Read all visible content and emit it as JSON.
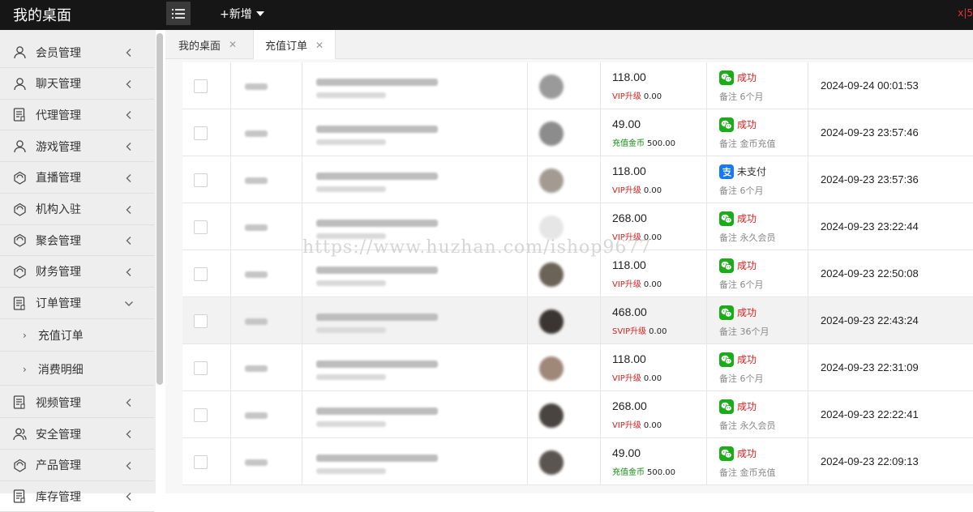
{
  "header": {
    "title": "我的桌面",
    "add_label": "+新增",
    "right_text": "x|5"
  },
  "sidebar": {
    "items": [
      {
        "label": "会员管理",
        "icon": "user-icon"
      },
      {
        "label": "聊天管理",
        "icon": "user-icon"
      },
      {
        "label": "代理管理",
        "icon": "document-icon"
      },
      {
        "label": "游戏管理",
        "icon": "user-icon"
      },
      {
        "label": "直播管理",
        "icon": "bell-icon"
      },
      {
        "label": "机构入驻",
        "icon": "bell-icon"
      },
      {
        "label": "聚会管理",
        "icon": "bell-icon"
      },
      {
        "label": "财务管理",
        "icon": "bell-icon"
      },
      {
        "label": "订单管理",
        "icon": "document-icon"
      }
    ],
    "sub_items": [
      {
        "label": "充值订单"
      },
      {
        "label": "消费明细"
      }
    ],
    "items_after": [
      {
        "label": "视频管理",
        "icon": "document-icon"
      },
      {
        "label": "安全管理",
        "icon": "users-icon"
      },
      {
        "label": "产品管理",
        "icon": "bell-icon"
      },
      {
        "label": "库存管理",
        "icon": "document-icon"
      }
    ]
  },
  "tabs": [
    {
      "label": "我的桌面"
    },
    {
      "label": "充值订单"
    }
  ],
  "colors": {
    "vip": "#e02020",
    "coin": "#0c8a0c",
    "success": "#e02020",
    "wechat": "#1aad19",
    "alipay": "#1677ff"
  },
  "orders": [
    {
      "amount": "118.00",
      "type": "VIP升级",
      "type_value": "0.00",
      "type_color": "vip",
      "pay": "wechat",
      "status": "成功",
      "remark": "备注 6个月",
      "time": "2024-09-24 00:01:53",
      "avatar": "#9a9a9a"
    },
    {
      "amount": "49.00",
      "type": "充值金币",
      "type_value": "500.00",
      "type_color": "coin",
      "pay": "wechat",
      "status": "成功",
      "remark": "备注 金币充值",
      "time": "2024-09-23 23:57:46",
      "avatar": "#8c8c8c"
    },
    {
      "amount": "118.00",
      "type": "VIP升级",
      "type_value": "0.00",
      "type_color": "vip",
      "pay": "alipay",
      "status": "未支付",
      "remark": "备注 6个月",
      "time": "2024-09-23 23:57:36",
      "avatar": "#a39b92"
    },
    {
      "amount": "268.00",
      "type": "VIP升级",
      "type_value": "0.00",
      "type_color": "vip",
      "pay": "wechat",
      "status": "成功",
      "remark": "备注 永久会员",
      "time": "2024-09-23 23:22:44",
      "avatar": "#e6e6e6"
    },
    {
      "amount": "118.00",
      "type": "VIP升级",
      "type_value": "0.00",
      "type_color": "vip",
      "pay": "wechat",
      "status": "成功",
      "remark": "备注 6个月",
      "time": "2024-09-23 22:50:08",
      "avatar": "#6b6358"
    },
    {
      "amount": "468.00",
      "type": "SVIP升级",
      "type_value": "0.00",
      "type_color": "vip",
      "pay": "wechat",
      "status": "成功",
      "remark": "备注 36个月",
      "time": "2024-09-23 22:43:24",
      "avatar": "#3a3532"
    },
    {
      "amount": "118.00",
      "type": "VIP升级",
      "type_value": "0.00",
      "type_color": "vip",
      "pay": "wechat",
      "status": "成功",
      "remark": "备注 6个月",
      "time": "2024-09-23 22:31:09",
      "avatar": "#a08878"
    },
    {
      "amount": "268.00",
      "type": "VIP升级",
      "type_value": "0.00",
      "type_color": "vip",
      "pay": "wechat",
      "status": "成功",
      "remark": "备注 永久会员",
      "time": "2024-09-23 22:22:41",
      "avatar": "#4a4440"
    },
    {
      "amount": "49.00",
      "type": "充值金币",
      "type_value": "500.00",
      "type_color": "coin",
      "pay": "wechat",
      "status": "成功",
      "remark": "备注 金币充值",
      "time": "2024-09-23 22:09:13",
      "avatar": "#5a5550"
    }
  ],
  "watermark": "https://www.huzhan.com/ishop9677"
}
